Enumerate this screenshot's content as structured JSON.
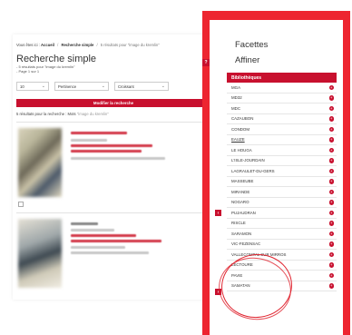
{
  "breadcrumb": {
    "prefix": "Vous êtes ici :",
    "home": "Accueil",
    "sep": "/",
    "parent": "Recherche simple",
    "current": "5 résultats pour \"image du kremlin\""
  },
  "page": {
    "title": "Recherche simple",
    "result_summary": "- 5 résultats pour \"image du kremlin\"",
    "page_info": "- Page 1 sur 1"
  },
  "controls": {
    "per_page": "10",
    "sort_by": "Pertinence",
    "order": "Croissant",
    "modify_button": "Modifier la recherche"
  },
  "results": {
    "label": "5 résultats pour la recherche : Mots",
    "query": "\"image du kremlin\""
  },
  "markers": {
    "help": "?",
    "prev": "‹",
    "next": "›"
  },
  "sidebar": {
    "facettes": "Facettes",
    "affiner": "Affiner",
    "group_title": "Bibliothèques",
    "add_icon": "+",
    "libraries": [
      "MGA",
      "MD32",
      "MDC",
      "CAZAUBON",
      "CONDOM",
      "EAUZE",
      "LE HOUGA",
      "L'ISLE-JOURDAIN",
      "LAGRAULET-DU-GERS",
      "MASSEUBE",
      "MIRANDE",
      "NOGARO",
      "PUJAUDRAN",
      "RISCLE",
      "SARAMON",
      "VIC-FEZENSAC",
      "VALLECOMTAL SUR MIRROS",
      "LECTOURE",
      "PAVIE",
      "SAMATAN"
    ]
  },
  "colors": {
    "accent": "#c8102e",
    "frame": "#ed2530"
  }
}
